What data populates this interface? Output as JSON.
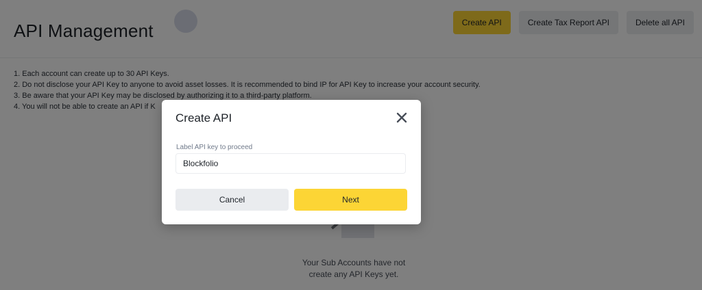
{
  "header": {
    "title": "API Management",
    "buttons": {
      "create_api": "Create API",
      "create_tax_report_api": "Create Tax Report API",
      "delete_all_api": "Delete all API"
    }
  },
  "notes": [
    "1. Each account can create up to 30 API Keys.",
    "2. Do not disclose your API Key to anyone to avoid asset losses. It is recommended to bind IP for API Key to increase your account security.",
    "3. Be aware that your API Key may be disclosed by authorizing it to a third-party platform.",
    "4. You will not be able to create an API if K"
  ],
  "empty_state": {
    "line1": "Your Sub Accounts have not",
    "line2": "create any API Keys yet."
  },
  "modal": {
    "title": "Create API",
    "close_icon": "close-icon",
    "field_label": "Label API key to proceed",
    "field_value": "Blockfolio",
    "cancel_label": "Cancel",
    "next_label": "Next"
  },
  "colors": {
    "accent_yellow": "#fcd535",
    "neutral_button": "#eaecef",
    "overlay": "rgba(0,0,0,0.5)"
  }
}
